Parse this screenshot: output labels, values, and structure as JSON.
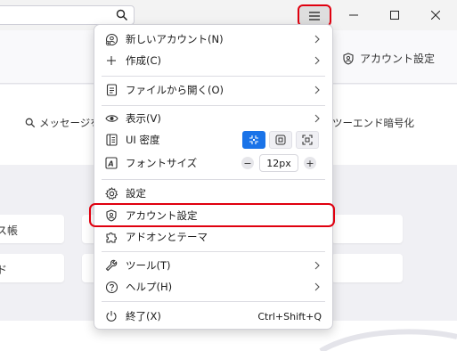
{
  "titlebar": {
    "search_placeholder": "",
    "icons": [
      "search-icon",
      "menu-icon",
      "minimize-icon",
      "maximize-icon",
      "close-icon"
    ]
  },
  "toolbar": {
    "account_settings_label": "アカウント設定"
  },
  "content": {
    "message_search_label": "メッセージを検",
    "e2e_label": "ツーエンド暗号化"
  },
  "cards": [
    {
      "label": "ス帳"
    },
    {
      "label": "ド"
    }
  ],
  "menu": {
    "new_account": "新しいアカウント(N)",
    "create": "作成(C)",
    "open_file": "ファイルから開く(O)",
    "view": "表示(V)",
    "ui_density": "UI 密度",
    "font_size": "フォントサイズ",
    "font_size_value": "12px",
    "font_minus": "−",
    "font_plus": "+",
    "settings": "設定",
    "account_settings": "アカウント設定",
    "addons": "アドオンとテーマ",
    "tools": "ツール(T)",
    "help": "ヘルプ(H)",
    "quit": "終了(X)",
    "quit_shortcut": "Ctrl+Shift+Q"
  },
  "colors": {
    "highlight": "#e0000f",
    "density_active": "#1a73e8"
  }
}
